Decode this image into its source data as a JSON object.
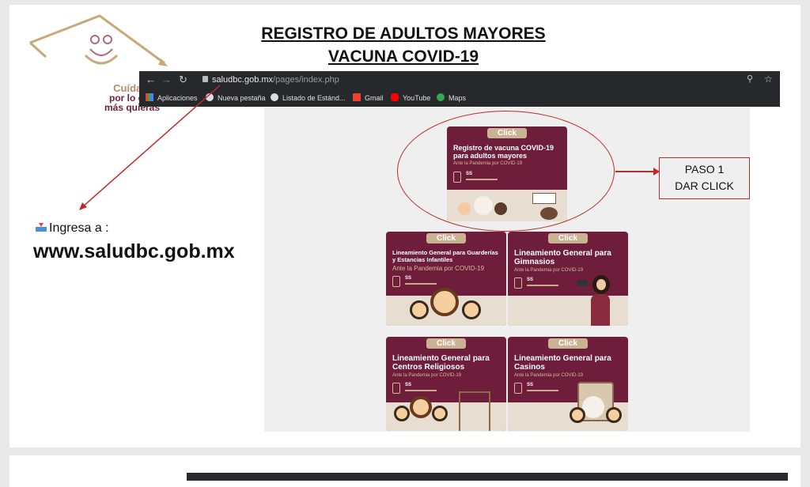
{
  "logo": {
    "line1": "Cuídate",
    "line2": "por lo que",
    "line3": "más quieras"
  },
  "title": {
    "line1": "REGISTRO DE ADULTOS MAYORES",
    "line2": "VACUNA COVID-19"
  },
  "browser": {
    "url_domain": "saludbc.gob.mx",
    "url_path": "/pages/index.php",
    "bookmarks": [
      {
        "label": "Aplicaciones",
        "icon": "apps-grid-icon"
      },
      {
        "label": "Nueva pestaña",
        "icon": "globe-icon"
      },
      {
        "label": "Listado de Estánd...",
        "icon": "globe-icon"
      },
      {
        "label": "Gmail",
        "icon": "gmail-icon"
      },
      {
        "label": "YouTube",
        "icon": "youtube-icon"
      },
      {
        "label": "Maps",
        "icon": "maps-icon"
      }
    ]
  },
  "cards": [
    {
      "click": "Click",
      "title": "Registro de vacuna COVID-19 para adultos mayores",
      "subtitle": "Ante la Pandemia por COVID-19",
      "agency": "SS"
    },
    {
      "click": "Click",
      "title": "Lineamiento General para Guarderías y Estancias Infantiles",
      "subtitle": "Ante la Pandemia por COVID-19",
      "agency": "SS"
    },
    {
      "click": "Click",
      "title": "Lineamiento General para Gimnasios",
      "subtitle": "Ante la Pandemia por COVID-19",
      "agency": "SS"
    },
    {
      "click": "Click",
      "title": "Lineamiento General para Centros Religiosos",
      "subtitle": "Ante la Pandemia por COVID-19",
      "agency": "SS"
    },
    {
      "click": "Click",
      "title": "Lineamiento General para Casinos",
      "subtitle": "Ante la Pandemia por COVID-19",
      "agency": "SS"
    }
  ],
  "step": {
    "line1": "PASO 1",
    "line2": "DAR CLICK"
  },
  "instructions": {
    "ingresa": "Ingresa a :",
    "site": "www.saludbc.gob.mx"
  },
  "colors": {
    "card_bg": "#6e1d3b",
    "click_badge": "#c9b393",
    "annotation": "#c22a2a",
    "browser_bar": "#26282c"
  }
}
